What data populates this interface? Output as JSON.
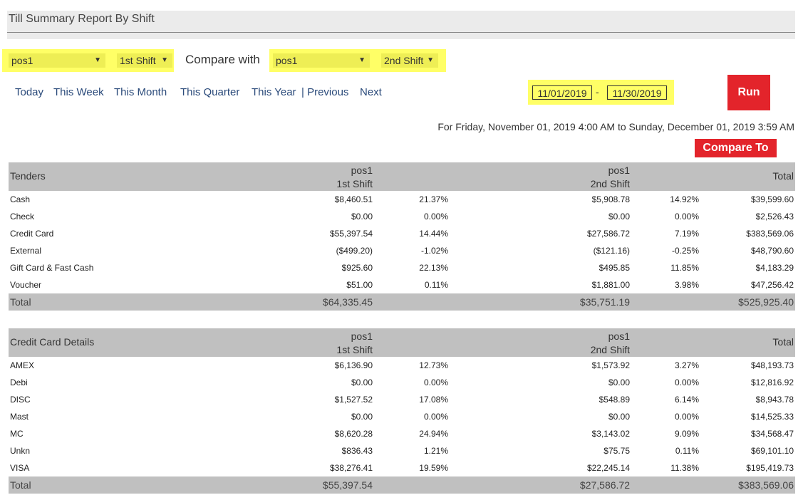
{
  "title": "Till Summary Report By Shift",
  "filters": {
    "terminal_a": "pos1",
    "shift_a": "1st Shift",
    "compare_label": "Compare with",
    "terminal_b": "pos1",
    "shift_b": "2nd Shift"
  },
  "nav": {
    "today": "Today",
    "this_week": "This Week",
    "this_month": "This Month",
    "this_quarter": "This Quarter",
    "this_year": "This Year",
    "previous": "| Previous",
    "next": "Next"
  },
  "dates": {
    "from": "11/01/2019",
    "separator": "-",
    "to": "11/30/2019"
  },
  "run_label": "Run",
  "range_text": "For Friday, November 01, 2019 4:00 AM to Sunday, December 01, 2019 3:59 AM",
  "compare_to_label": "Compare To",
  "tenders": {
    "header": {
      "label": "Tenders",
      "a_line1": "pos1",
      "a_line2": "1st Shift",
      "b_line1": "pos1",
      "b_line2": "2nd Shift",
      "total": "Total"
    },
    "rows": [
      {
        "name": "Cash",
        "a": "$8,460.51",
        "ap": "21.37%",
        "b": "$5,908.78",
        "bp": "14.92%",
        "t": "$39,599.60"
      },
      {
        "name": "Check",
        "a": "$0.00",
        "ap": "0.00%",
        "b": "$0.00",
        "bp": "0.00%",
        "t": "$2,526.43"
      },
      {
        "name": "Credit Card",
        "a": "$55,397.54",
        "ap": "14.44%",
        "b": "$27,586.72",
        "bp": "7.19%",
        "t": "$383,569.06"
      },
      {
        "name": "External",
        "a": "($499.20)",
        "ap": "-1.02%",
        "b": "($121.16)",
        "bp": "-0.25%",
        "t": "$48,790.60"
      },
      {
        "name": "Gift Card & Fast Cash",
        "a": "$925.60",
        "ap": "22.13%",
        "b": "$495.85",
        "bp": "11.85%",
        "t": "$4,183.29"
      },
      {
        "name": "Voucher",
        "a": "$51.00",
        "ap": "0.11%",
        "b": "$1,881.00",
        "bp": "3.98%",
        "t": "$47,256.42"
      }
    ],
    "total": {
      "name": "Total",
      "a": "$64,335.45",
      "b": "$35,751.19",
      "t": "$525,925.40"
    }
  },
  "cc": {
    "header": {
      "label": "Credit Card Details",
      "a_line1": "pos1",
      "a_line2": "1st Shift",
      "b_line1": "pos1",
      "b_line2": "2nd Shift",
      "total": "Total"
    },
    "rows": [
      {
        "name": "AMEX",
        "a": "$6,136.90",
        "ap": "12.73%",
        "b": "$1,573.92",
        "bp": "3.27%",
        "t": "$48,193.73"
      },
      {
        "name": "Debi",
        "a": "$0.00",
        "ap": "0.00%",
        "b": "$0.00",
        "bp": "0.00%",
        "t": "$12,816.92"
      },
      {
        "name": "DISC",
        "a": "$1,527.52",
        "ap": "17.08%",
        "b": "$548.89",
        "bp": "6.14%",
        "t": "$8,943.78"
      },
      {
        "name": "Mast",
        "a": "$0.00",
        "ap": "0.00%",
        "b": "$0.00",
        "bp": "0.00%",
        "t": "$14,525.33"
      },
      {
        "name": "MC",
        "a": "$8,620.28",
        "ap": "24.94%",
        "b": "$3,143.02",
        "bp": "9.09%",
        "t": "$34,568.47"
      },
      {
        "name": "Unkn",
        "a": "$836.43",
        "ap": "1.21%",
        "b": "$75.75",
        "bp": "0.11%",
        "t": "$69,101.10"
      },
      {
        "name": "VISA",
        "a": "$38,276.41",
        "ap": "19.59%",
        "b": "$22,245.14",
        "bp": "11.38%",
        "t": "$195,419.73"
      }
    ],
    "total": {
      "name": "Total",
      "a": "$55,397.54",
      "b": "$27,586.72",
      "t": "$383,569.06"
    }
  }
}
